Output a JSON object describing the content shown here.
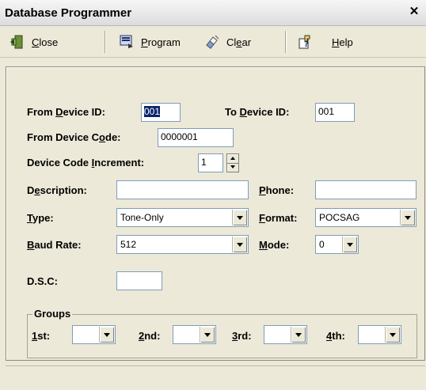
{
  "window": {
    "title": "Database Programmer"
  },
  "toolbar": {
    "close": {
      "pre": "",
      "ul": "C",
      "post": "lose"
    },
    "program": {
      "pre": "",
      "ul": "P",
      "post": "rogram"
    },
    "clear": {
      "pre": "Cl",
      "ul": "e",
      "post": "ar"
    },
    "help": {
      "pre": "",
      "ul": "H",
      "post": "elp"
    }
  },
  "form": {
    "from_device_id": {
      "pre": "From ",
      "ul": "D",
      "post": "evice ID:",
      "value": "001"
    },
    "to_device_id": {
      "pre": "To ",
      "ul": "D",
      "post": "evice ID:",
      "value": "001"
    },
    "from_device_code": {
      "pre": "From Device C",
      "ul": "o",
      "post": "de:",
      "value": "0000001"
    },
    "increment": {
      "pre": "Device Code ",
      "ul": "I",
      "post": "ncrement:",
      "value": "1"
    },
    "description": {
      "pre": "D",
      "ul": "e",
      "post": "scription:",
      "value": ""
    },
    "phone": {
      "pre": "",
      "ul": "P",
      "post": "hone:",
      "value": ""
    },
    "type": {
      "pre": "",
      "ul": "T",
      "post": "ype:",
      "value": "Tone-Only"
    },
    "format": {
      "pre": "",
      "ul": "F",
      "post": "ormat:",
      "value": "POCSAG"
    },
    "baud": {
      "pre": "",
      "ul": "B",
      "post": "aud Rate:",
      "value": "512"
    },
    "mode": {
      "pre": "",
      "ul": "M",
      "post": "ode:",
      "value": "0"
    },
    "dsc": {
      "label": "D.S.C:",
      "value": ""
    }
  },
  "groups": {
    "title": "Groups",
    "g1": {
      "ul": "1",
      "post": "st:",
      "value": ""
    },
    "g2": {
      "ul": "2",
      "post": "nd:",
      "value": ""
    },
    "g3": {
      "ul": "3",
      "post": "rd:",
      "value": ""
    },
    "g4": {
      "ul": "4",
      "post": "th:",
      "value": ""
    }
  }
}
